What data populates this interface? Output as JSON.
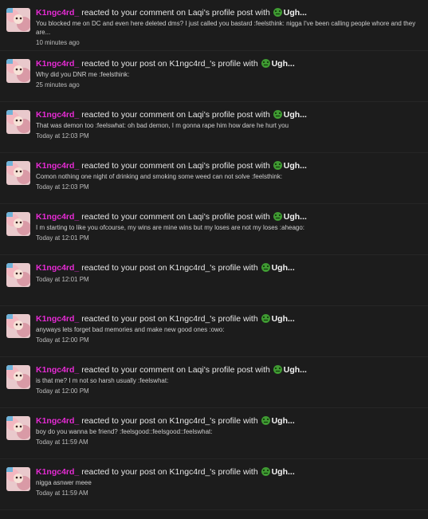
{
  "alerts": [
    {
      "username": "K1ngc4rd_",
      "action": "reacted to your comment on Laqi's profile post with",
      "reaction": "Ugh...",
      "snippet": "You blocked me on DC and even here deleted dms? I just called you bastard :feelsthink: nigga I've been calling people whore and they are...",
      "time": "10 minutes ago"
    },
    {
      "username": "K1ngc4rd_",
      "action": "reacted to your post on K1ngc4rd_'s profile with",
      "reaction": "Ugh...",
      "snippet": "Why did you DNR me :feelsthink:",
      "time": "25 minutes ago"
    },
    {
      "username": "K1ngc4rd_",
      "action": "reacted to your comment on Laqi's profile post with",
      "reaction": "Ugh...",
      "snippet": "That was demon too :feelswhat: oh bad demon, I m gonna rape him how dare he hurt you",
      "time": "Today at 12:03 PM"
    },
    {
      "username": "K1ngc4rd_",
      "action": "reacted to your comment on Laqi's profile post with",
      "reaction": "Ugh...",
      "snippet": "Comon nothing one night of drinking and smoking some weed can not solve :feelsthink:",
      "time": "Today at 12:03 PM"
    },
    {
      "username": "K1ngc4rd_",
      "action": "reacted to your comment on Laqi's profile post with",
      "reaction": "Ugh...",
      "snippet": "I m starting to like you ofcourse, my wins are mine wins but my loses are not my loses :aheago:",
      "time": "Today at 12:01 PM"
    },
    {
      "username": "K1ngc4rd_",
      "action": "reacted to your post on K1ngc4rd_'s profile with",
      "reaction": "Ugh...",
      "snippet": "",
      "time": "Today at 12:01 PM"
    },
    {
      "username": "K1ngc4rd_",
      "action": "reacted to your post on K1ngc4rd_'s profile with",
      "reaction": "Ugh...",
      "snippet": "anyways lets forget bad memories and make new good ones :owo:",
      "time": "Today at 12:00 PM"
    },
    {
      "username": "K1ngc4rd_",
      "action": "reacted to your comment on Laqi's profile post with",
      "reaction": "Ugh...",
      "snippet": "is that me? I m not so harsh usually :feelswhat:",
      "time": "Today at 12:00 PM"
    },
    {
      "username": "K1ngc4rd_",
      "action": "reacted to your post on K1ngc4rd_'s profile with",
      "reaction": "Ugh...",
      "snippet": "boy do you wanna be friend? :feelsgood::feelsgood::feelswhat:",
      "time": "Today at 11:59 AM"
    },
    {
      "username": "K1ngc4rd_",
      "action": "reacted to your post on K1ngc4rd_'s profile with",
      "reaction": "Ugh...",
      "snippet": "nigga asnwer meee",
      "time": "Today at 11:59 AM"
    }
  ],
  "icons": {
    "avatar": "user-avatar-image",
    "reaction": "ugh-reaction-emoji-icon"
  },
  "colors": {
    "background": "#1c1c1c",
    "username": "#e62bd4",
    "reaction_emoji": "#3f9a32",
    "text": "#e6e6e6",
    "muted": "#bdbdbd"
  }
}
